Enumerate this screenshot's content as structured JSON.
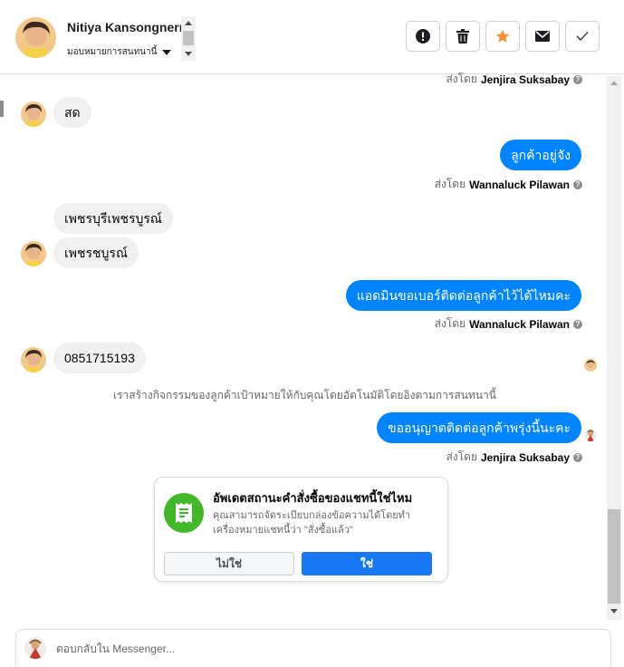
{
  "header": {
    "contact_name": "Nitiya Kansongnern",
    "assign_label": "มอบหมายการสนทนานี้",
    "actions": {
      "report": "exclamation-icon",
      "delete": "trash-icon",
      "star": "star-icon",
      "mail": "envelope-icon",
      "done": "check-icon"
    }
  },
  "messages": [
    {
      "type": "sent_by",
      "label": "ส่งโดย",
      "name": "Jenjira Suksabay"
    },
    {
      "type": "in",
      "text": "สด"
    },
    {
      "type": "out",
      "text": "ลูกค้าอยู่จัง"
    },
    {
      "type": "sent_by",
      "label": "ส่งโดย",
      "name": "Wannaluck Pilawan"
    },
    {
      "type": "in",
      "text": "เพชรบุรีเพชรบูรณ์"
    },
    {
      "type": "in",
      "text": "เพชรชบูรณ์"
    },
    {
      "type": "out",
      "text": "แอดมินขอเบอร์ติดต่อลูกค้าไว้ได้ไหมคะ"
    },
    {
      "type": "sent_by",
      "label": "ส่งโดย",
      "name": "Wannaluck Pilawan"
    },
    {
      "type": "in",
      "text": "0851715193"
    },
    {
      "type": "system",
      "text": "เราสร้างกิจกรรมของลูกค้าเป้าหมายให้กับคุณโดยอัตโนมัติโดยอิงตามการสนทนานี้"
    },
    {
      "type": "out",
      "text": "ขออนุญาตติดต่อลูกค้าพรุ่งนี้นะคะ"
    },
    {
      "type": "sent_by",
      "label": "ส่งโดย",
      "name": "Jenjira Suksabay"
    }
  ],
  "card": {
    "title": "อัพเดตสถานะคำสั่งซื้อของแชทนี้ใช่ไหม",
    "description": "คุณสามารถจัดระเบียบกล่องข้อความได้โดยทำเครื่องหมายแชทนี้ว่า \"สั่งซื้อแล้ว\"",
    "no_label": "ไม่ใช่",
    "yes_label": "ใช่",
    "icon": "receipt-icon"
  },
  "composer": {
    "placeholder": "ตอบกลับใน Messenger..."
  },
  "colors": {
    "outgoing_bubble": "#0084ff",
    "incoming_bubble": "#f0f0f0",
    "primary_button": "#1877f2",
    "card_icon": "#42b72a",
    "star": "#f7923b"
  }
}
